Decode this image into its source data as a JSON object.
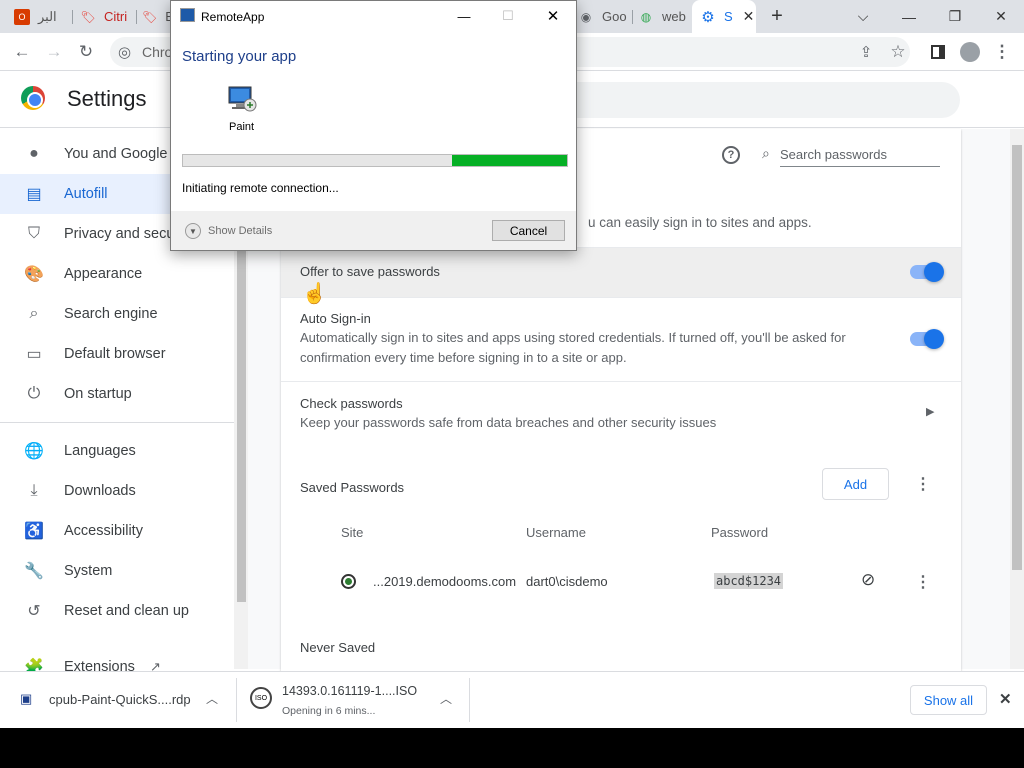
{
  "browser": {
    "tabs": [
      {
        "label": "البر",
        "icon": "outlook-icon",
        "color": "#d83b01"
      },
      {
        "label": "Citri",
        "icon": "tag-icon",
        "color": "#e8453c"
      },
      {
        "label": "E",
        "icon": "tag-icon",
        "color": "#e8453c"
      },
      {
        "label": "Goo",
        "icon": "globe-icon",
        "color": "#5f6368"
      },
      {
        "label": "web",
        "icon": "colorful-globe-icon",
        "color": "#34a853"
      },
      {
        "label": "S",
        "icon": "gear-icon",
        "color": "#1a73e8",
        "active": true
      }
    ],
    "new_tab_symbol": "+",
    "address_text": "Chro",
    "window_controls": {
      "tab_search": "⌵",
      "minimize": "—",
      "restore": "❐",
      "close": "✕"
    }
  },
  "settings": {
    "title": "Settings",
    "nav": [
      {
        "label": "You and Google",
        "icon": "person-icon"
      },
      {
        "label": "Autofill",
        "icon": "clipboard-icon",
        "selected": true
      },
      {
        "label": "Privacy and secu",
        "icon": "shield-icon"
      },
      {
        "label": "Appearance",
        "icon": "palette-icon"
      },
      {
        "label": "Search engine",
        "icon": "search-icon"
      },
      {
        "label": "Default browser",
        "icon": "browser-icon"
      },
      {
        "label": "On startup",
        "icon": "power-icon"
      },
      {
        "label": "Languages",
        "icon": "globe-icon"
      },
      {
        "label": "Downloads",
        "icon": "download-icon"
      },
      {
        "label": "Accessibility",
        "icon": "accessibility-icon"
      },
      {
        "label": "System",
        "icon": "wrench-icon"
      },
      {
        "label": "Reset and clean up",
        "icon": "history-icon"
      },
      {
        "label": "Extensions",
        "icon": "puzzle-icon"
      }
    ],
    "passwords": {
      "search_placeholder": "Search passwords",
      "intro_partial": "u can easily sign in to sites and apps.",
      "offer_to_save": {
        "label": "Offer to save passwords",
        "enabled": true
      },
      "auto_signin": {
        "label": "Auto Sign-in",
        "description_line1": "Automatically sign in to sites and apps using stored credentials. If turned off, you'll be asked for",
        "description_line2": "confirmation every time before signing in to a site or app.",
        "enabled": true
      },
      "check_passwords": {
        "label": "Check passwords",
        "description": "Keep your passwords safe from data breaches and other security issues"
      },
      "saved_heading": "Saved Passwords",
      "add_label": "Add",
      "columns": {
        "site": "Site",
        "username": "Username",
        "password": "Password"
      },
      "entries": [
        {
          "site": "...2019.demodooms.com",
          "username": "dart0\\cisdemo",
          "password": "abcd$1234"
        }
      ],
      "never_saved_heading": "Never Saved"
    }
  },
  "downloads": {
    "items": [
      {
        "name": "cpub-Paint-QuickS....rdp",
        "status": ""
      },
      {
        "name": "14393.0.161119-1....ISO",
        "status": "Opening in 6 mins..."
      }
    ],
    "show_all": "Show all"
  },
  "remoteapp_dialog": {
    "title": "RemoteApp",
    "heading": "Starting your app",
    "app_name": "Paint",
    "progress": 0.3,
    "status": "Initiating remote connection...",
    "show_details": "Show Details",
    "cancel": "Cancel"
  }
}
